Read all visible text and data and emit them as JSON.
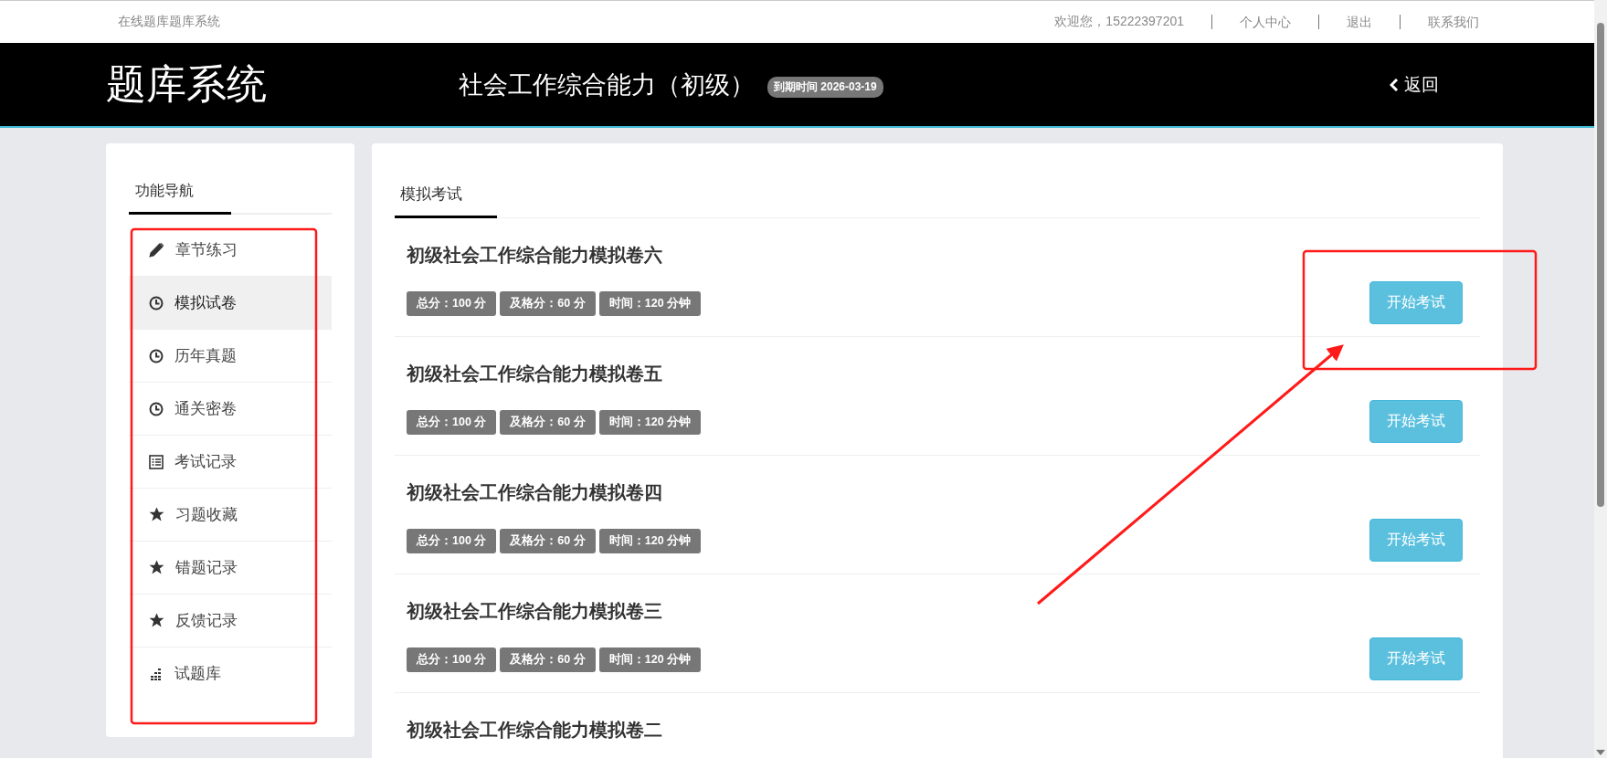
{
  "top_bar": {
    "site_name": "在线题库题库系统",
    "links": [
      "欢迎您，15222397201",
      "个人中心",
      "退出",
      "联系我们"
    ]
  },
  "header": {
    "logo": "题库系统",
    "course_title": "社会工作综合能力（初级）",
    "expiry_badge": "到期时间 2026-03-19",
    "back_link": "返回"
  },
  "sidebar": {
    "tab": "功能导航",
    "items": [
      {
        "label": "章节练习",
        "kind": "pencil",
        "selected": false
      },
      {
        "label": "模拟试卷",
        "kind": "clock",
        "selected": true
      },
      {
        "label": "历年真题",
        "kind": "clock",
        "selected": false
      },
      {
        "label": "通关密卷",
        "kind": "clock",
        "selected": false
      },
      {
        "label": "考试记录",
        "kind": "list",
        "selected": false
      },
      {
        "label": "习题收藏",
        "kind": "star",
        "selected": false
      },
      {
        "label": "错题记录",
        "kind": "star",
        "selected": false
      },
      {
        "label": "反馈记录",
        "kind": "star",
        "selected": false
      },
      {
        "label": "试题库",
        "kind": "bars",
        "selected": false
      }
    ]
  },
  "main": {
    "tab": "模拟考试",
    "exams": [
      {
        "title": "初级社会工作综合能力模拟卷六",
        "tags": [
          "总分：100 分",
          "及格分：60 分",
          "时间：120 分钟"
        ],
        "button": "开始考试"
      },
      {
        "title": "初级社会工作综合能力模拟卷五",
        "tags": [
          "总分：100 分",
          "及格分：60 分",
          "时间：120 分钟"
        ],
        "button": "开始考试"
      },
      {
        "title": "初级社会工作综合能力模拟卷四",
        "tags": [
          "总分：100 分",
          "及格分：60 分",
          "时间：120 分钟"
        ],
        "button": "开始考试"
      },
      {
        "title": "初级社会工作综合能力模拟卷三",
        "tags": [
          "总分：100 分",
          "及格分：60 分",
          "时间：120 分钟"
        ],
        "button": "开始考试"
      },
      {
        "title": "初级社会工作综合能力模拟卷二"
      }
    ]
  }
}
